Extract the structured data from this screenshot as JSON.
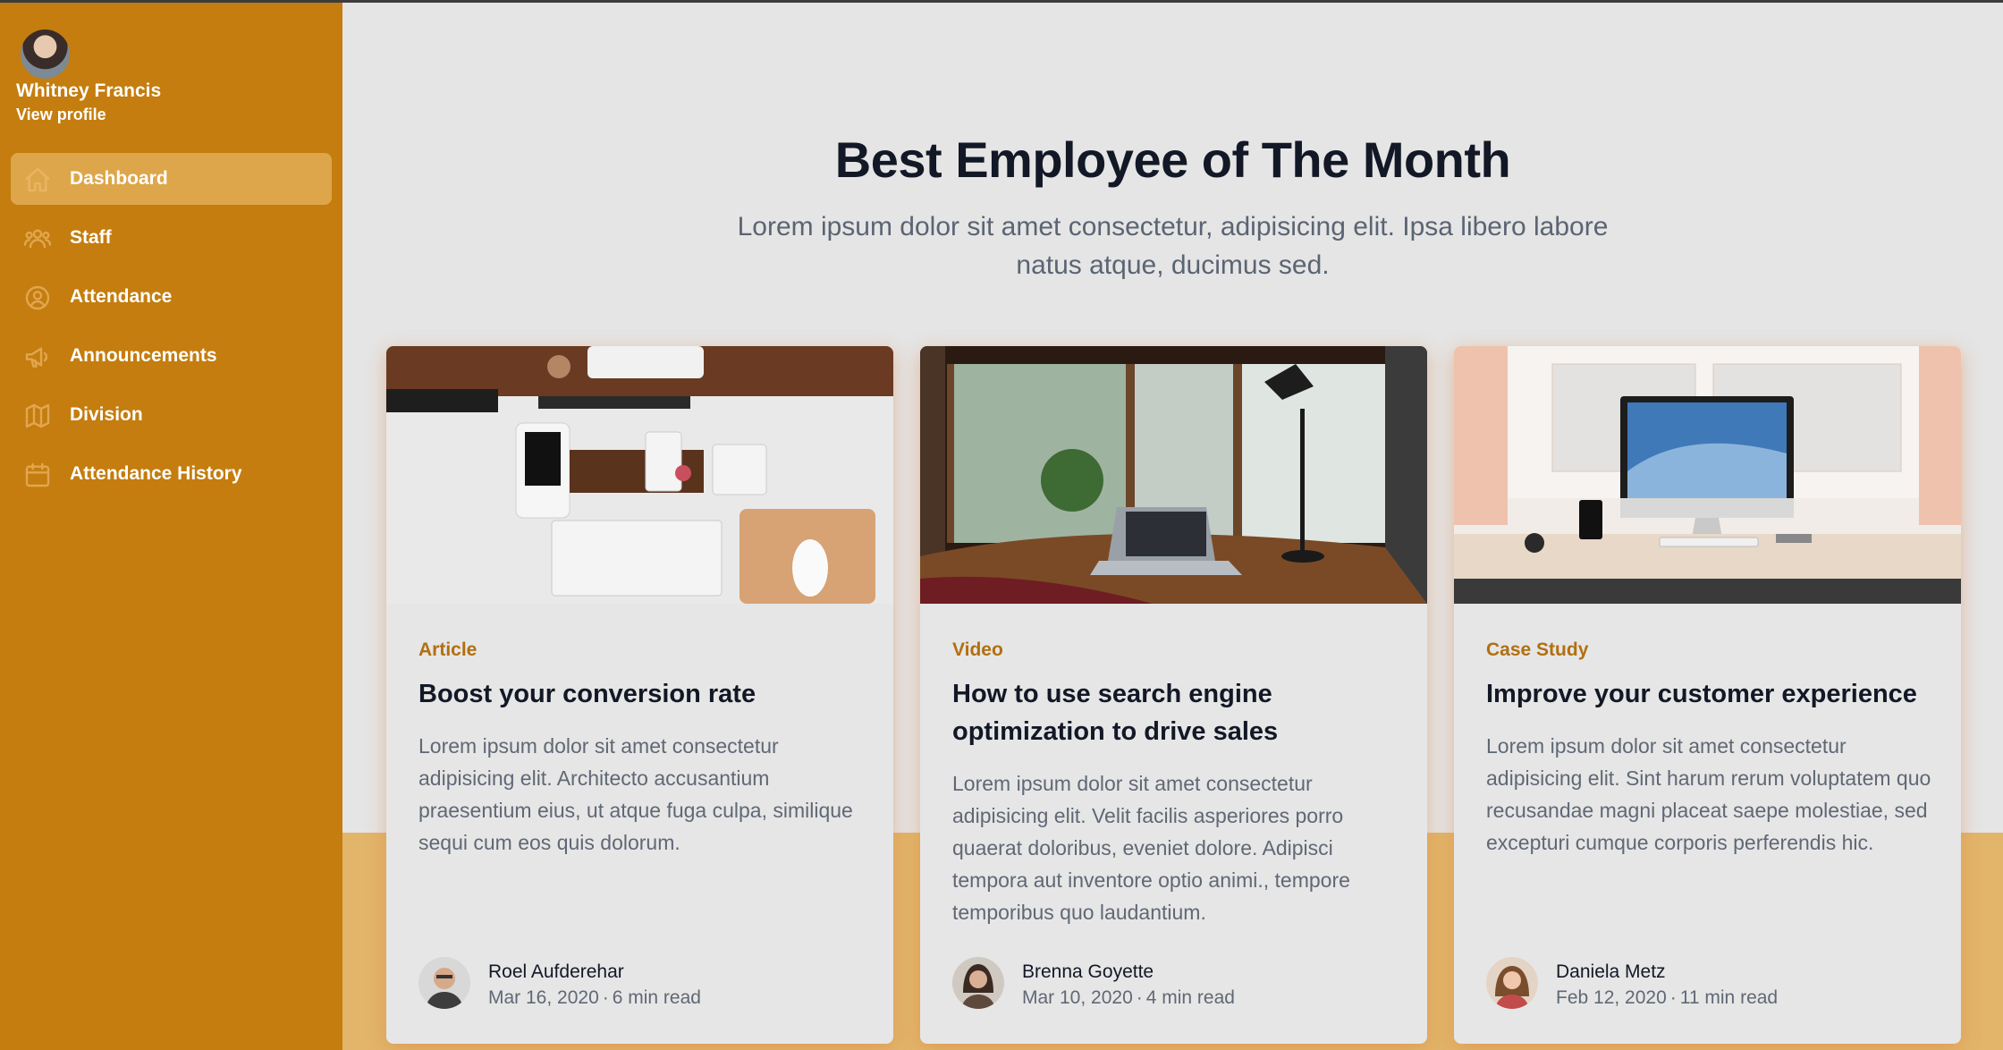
{
  "user": {
    "name": "Whitney Francis",
    "view_profile": "View profile"
  },
  "sidebar": {
    "items": [
      {
        "label": "Dashboard",
        "icon": "home-icon",
        "active": true
      },
      {
        "label": "Staff",
        "icon": "users-icon",
        "active": false
      },
      {
        "label": "Attendance",
        "icon": "attendance-icon",
        "active": false
      },
      {
        "label": "Announcements",
        "icon": "megaphone-icon",
        "active": false
      },
      {
        "label": "Division",
        "icon": "map-icon",
        "active": false
      },
      {
        "label": "Attendance History",
        "icon": "calendar-icon",
        "active": false
      }
    ]
  },
  "main": {
    "title": "Best Employee of The Month",
    "subtitle": "Lorem ipsum dolor sit amet consectetur, adipisicing elit. Ipsa libero labore natus atque, ducimus sed."
  },
  "cards": [
    {
      "category": "Article",
      "title": "Boost your conversion rate",
      "description": "Lorem ipsum dolor sit amet consectetur adipisicing elit. Architecto accusantium praesentium eius, ut atque fuga culpa, similique sequi cum eos quis dolorum.",
      "author": "Roel Aufderehar",
      "date": "Mar 16, 2020",
      "read_time": "6 min read"
    },
    {
      "category": "Video",
      "title": "How to use search engine optimization to drive sales",
      "description": "Lorem ipsum dolor sit amet consectetur adipisicing elit. Velit facilis asperiores porro quaerat doloribus, eveniet dolore. Adipisci tempora aut inventore optio animi., tempore temporibus quo laudantium.",
      "author": "Brenna Goyette",
      "date": "Mar 10, 2020",
      "read_time": "4 min read"
    },
    {
      "category": "Case Study",
      "title": "Improve your customer experience",
      "description": "Lorem ipsum dolor sit amet consectetur adipisicing elit. Sint harum rerum voluptatem quo recusandae magni placeat saepe molestiae, sed excepturi cumque corporis perferendis hic.",
      "author": "Daniela Metz",
      "date": "Feb 12, 2020",
      "read_time": "11 min read"
    }
  ],
  "colors": {
    "sidebar": "#c47d0e",
    "sidebar_active": "#dea64a",
    "background": "#e5e5e5",
    "accent_band": "#e2b56a",
    "category_text": "#b16f10"
  }
}
